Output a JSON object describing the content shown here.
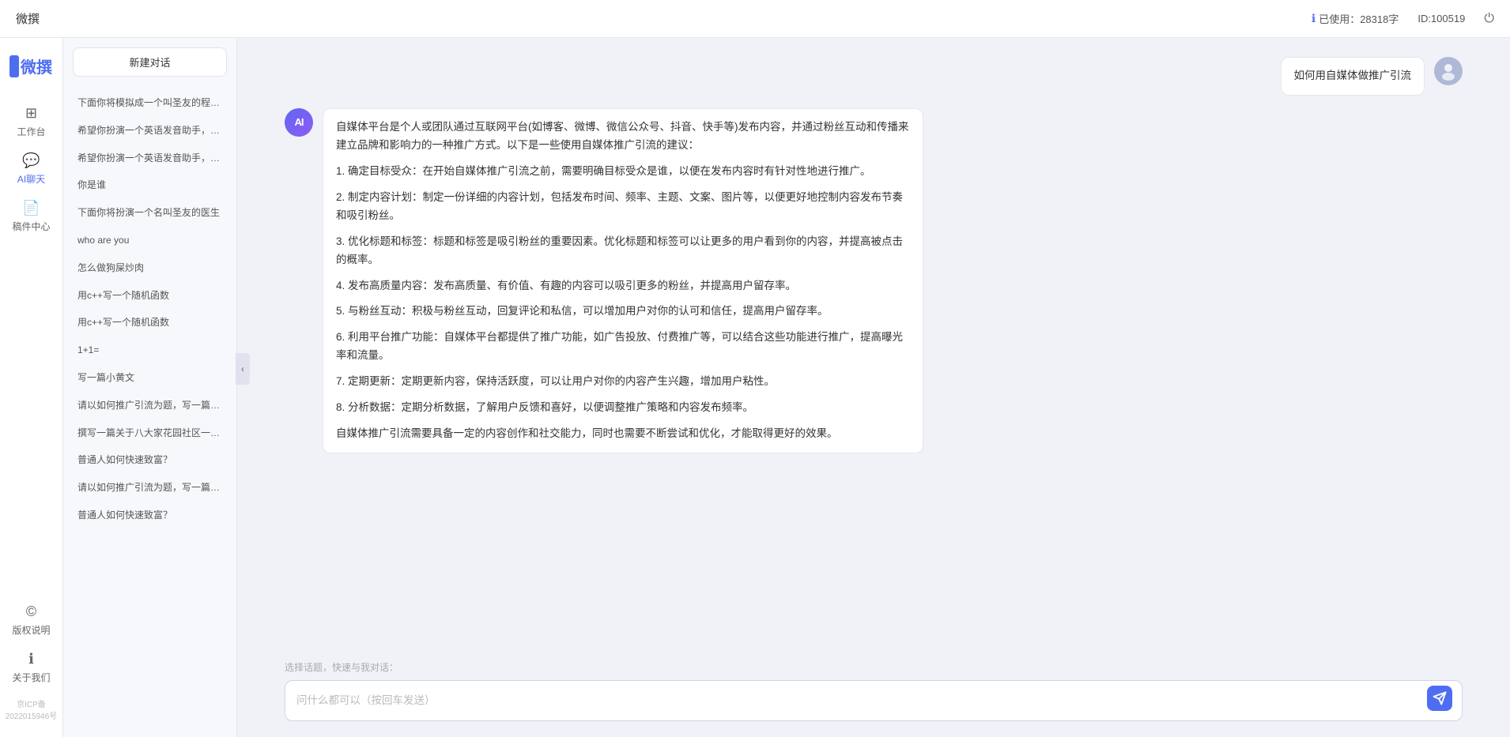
{
  "topbar": {
    "title": "微撰",
    "usage_label": "已使用：28318字",
    "id_label": "ID:100519",
    "info_icon": "ℹ",
    "power_icon": "⏻"
  },
  "left_nav": {
    "logo_text": "微撰",
    "items": [
      {
        "id": "workbench",
        "label": "工作台",
        "icon": "⊞",
        "active": false
      },
      {
        "id": "ai-chat",
        "label": "AI聊天",
        "icon": "💬",
        "active": true
      },
      {
        "id": "drafts",
        "label": "稿件中心",
        "icon": "📄",
        "active": false
      }
    ],
    "bottom_items": [
      {
        "id": "copyright",
        "label": "版权说明",
        "icon": "©"
      },
      {
        "id": "about",
        "label": "关于我们",
        "icon": "ℹ"
      }
    ],
    "icp": "京ICP备2022015946号"
  },
  "history_sidebar": {
    "new_chat_label": "新建对话",
    "items": [
      "下面你将模拟成一个叫圣友的程序员，我说...",
      "希望你扮演一个英语发音助手，我提供给你...",
      "希望你扮演一个英语发音助手，我提供给你...",
      "你是谁",
      "下面你将扮演一个名叫圣友的医生",
      "who are you",
      "怎么做狗屎炒肉",
      "用c++写一个随机函数",
      "用c++写一个随机函数",
      "1+1=",
      "写一篇小黄文",
      "请以如何推广引流为题，写一篇大纲",
      "撰写一篇关于八大家花园社区一刻钟便民生...",
      "普通人如何快速致富？",
      "请以如何推广引流为题，写一篇大纲",
      "普通人如何快速致富？"
    ]
  },
  "chat": {
    "user_message": "如何用自媒体做推广引流",
    "ai_response_paragraphs": [
      "自媒体平台是个人或团队通过互联网平台(如博客、微博、微信公众号、抖音、快手等)发布内容，并通过粉丝互动和传播来建立品牌和影响力的一种推广方式。以下是一些使用自媒体推广引流的建议：",
      "1. 确定目标受众：在开始自媒体推广引流之前，需要明确目标受众是谁，以便在发布内容时有针对性地进行推广。",
      "2. 制定内容计划：制定一份详细的内容计划，包括发布时间、频率、主题、文案、图片等，以便更好地控制内容发布节奏和吸引粉丝。",
      "3. 优化标题和标签：标题和标签是吸引粉丝的重要因素。优化标题和标签可以让更多的用户看到你的内容，并提高被点击的概率。",
      "4. 发布高质量内容：发布高质量、有价值、有趣的内容可以吸引更多的粉丝，并提高用户留存率。",
      "5. 与粉丝互动：积极与粉丝互动，回复评论和私信，可以增加用户对你的认可和信任，提高用户留存率。",
      "6. 利用平台推广功能：自媒体平台都提供了推广功能，如广告投放、付费推广等，可以结合这些功能进行推广，提高曝光率和流量。",
      "7. 定期更新：定期更新内容，保持活跃度，可以让用户对你的内容产生兴趣，增加用户粘性。",
      "8. 分析数据：定期分析数据，了解用户反馈和喜好，以便调整推广策略和内容发布频率。",
      "自媒体推广引流需要具备一定的内容创作和社交能力，同时也需要不断尝试和优化，才能取得更好的效果。"
    ],
    "quick_topics_label": "选择话题，快速与我对话：",
    "input_placeholder": "问什么都可以（按回车发送）"
  }
}
